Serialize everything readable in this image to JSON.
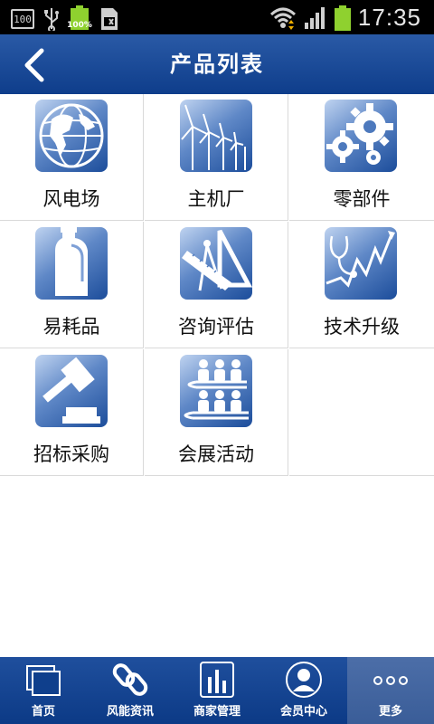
{
  "status_bar": {
    "indicator_left": "100",
    "battery_percent_label": "100%",
    "time": "17:35"
  },
  "header": {
    "title": "产品列表"
  },
  "products": [
    {
      "label": "风电场",
      "icon": "globe-icon"
    },
    {
      "label": "主机厂",
      "icon": "wind-turbines-icon"
    },
    {
      "label": "零部件",
      "icon": "gears-icon"
    },
    {
      "label": "易耗品",
      "icon": "bottle-icon"
    },
    {
      "label": "咨询评估",
      "icon": "drafting-tools-icon"
    },
    {
      "label": "技术升级",
      "icon": "stethoscope-graph-icon"
    },
    {
      "label": "招标采购",
      "icon": "gavel-icon"
    },
    {
      "label": "会展活动",
      "icon": "meeting-icon"
    }
  ],
  "tabbar": {
    "tabs": [
      {
        "label": "首页",
        "icon": "home-pages-icon"
      },
      {
        "label": "风能资讯",
        "icon": "link-icon"
      },
      {
        "label": "商家管理",
        "icon": "bar-chart-icon"
      },
      {
        "label": "会员中心",
        "icon": "user-icon"
      },
      {
        "label": "更多",
        "icon": "more-dots-icon"
      }
    ],
    "active_index": 4
  },
  "colors": {
    "header_bg": "#1a4a98",
    "tab_active_bg": "#4466a0",
    "icon_tile": "#2a5aa6"
  }
}
